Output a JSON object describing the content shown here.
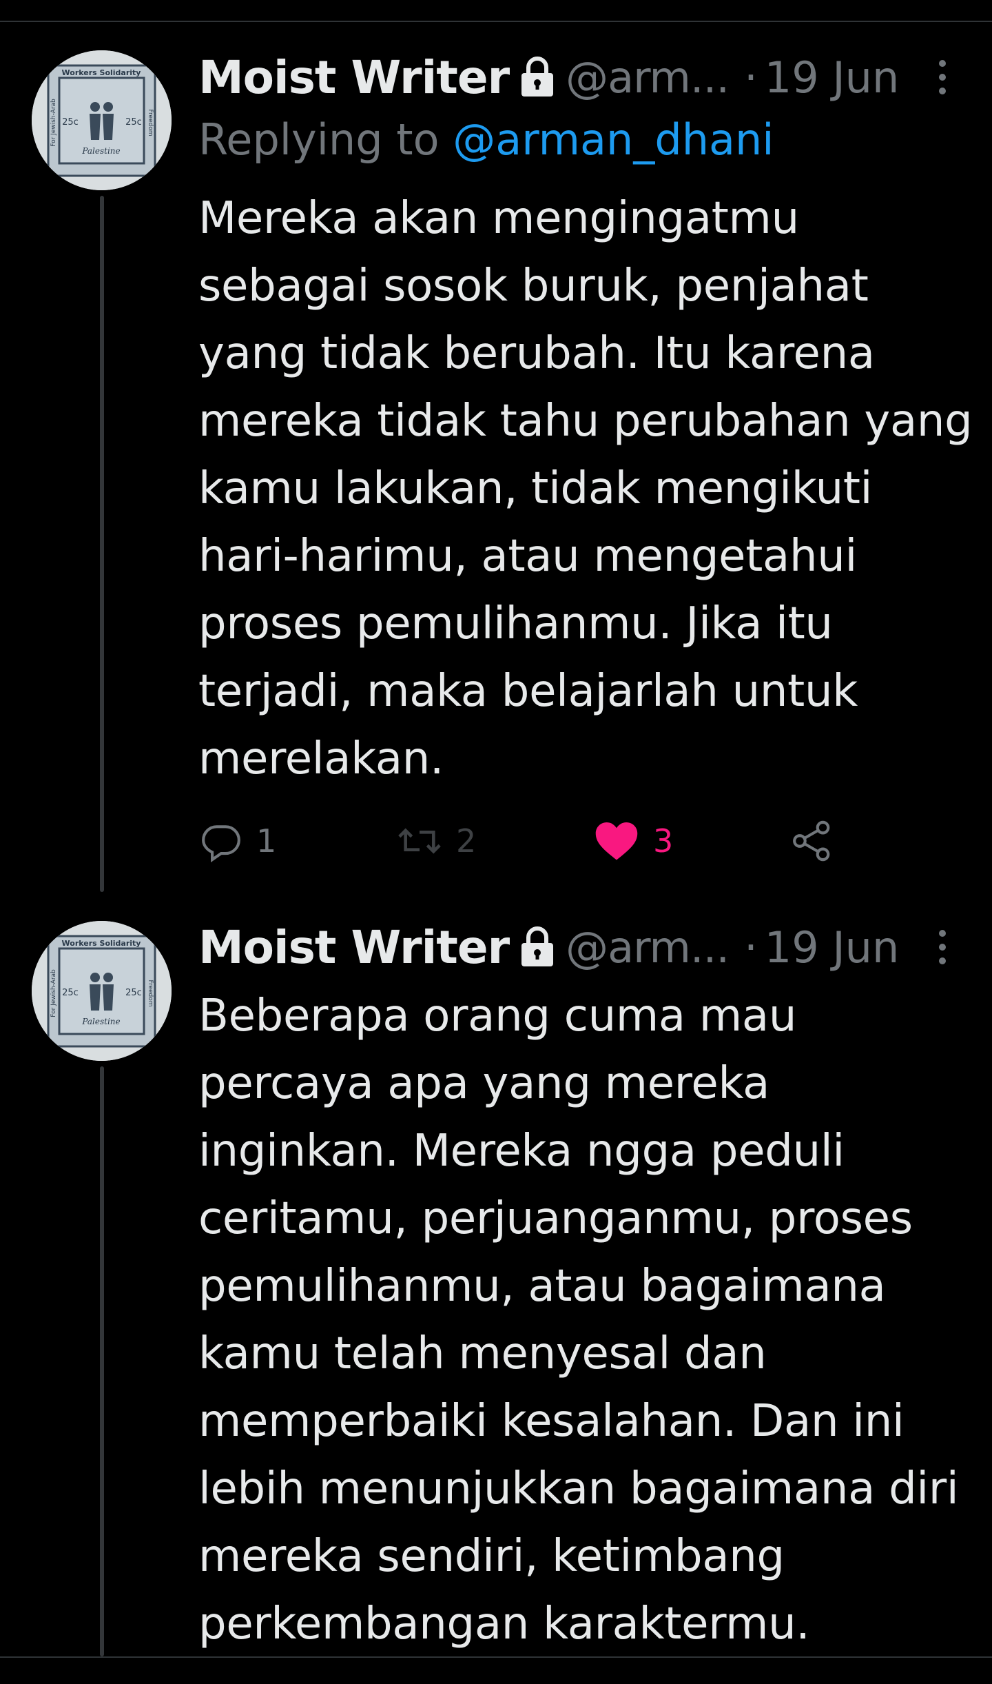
{
  "tweets": [
    {
      "author_name": "Moist Writer",
      "handle": "@arm...",
      "separator": "·",
      "date": "19 Jun",
      "replying_to_label": "Replying to",
      "replying_to_handle": "@arman_dhani",
      "text": "Mereka akan mengingatmu sebagai sosok buruk, penjahat yang tidak berubah. Itu karena mereka tidak tahu perubahan yang kamu lakukan, tidak mengikuti hari-harimu, atau mengetahui proses pemulihanmu. Jika itu terjadi, maka belajarlah untuk merelakan.",
      "reply_count": "1",
      "retweet_count": "2",
      "like_count": "3",
      "liked": true
    },
    {
      "author_name": "Moist Writer",
      "handle": "@arm...",
      "separator": "·",
      "date": "19 Jun",
      "text": "Beberapa orang cuma mau percaya apa yang mereka inginkan. Mereka ngga peduli ceritamu, perjuanganmu, proses pemulihanmu, atau bagaimana kamu telah menyesal dan memperbaiki kesalahan. Dan ini lebih menunjukkan bagaimana diri mereka sendiri, ketimbang perkembangan karaktermu."
    }
  ],
  "avatar": {
    "stamp_text_top": "Workers Solidarity",
    "stamp_text_left": "For Jewish-Arab",
    "stamp_text_right": "Freedom",
    "stamp_value_left": "25c",
    "stamp_value_right": "25c",
    "stamp_place": "Palestine"
  },
  "colors": {
    "background": "#000000",
    "text": "#e7e9ea",
    "secondary": "#71767b",
    "link": "#1d9bf0",
    "like": "#f91880",
    "divider": "#2f3336",
    "thread_line": "#333639"
  },
  "icons": {
    "lock": "lock-icon",
    "more": "more-vertical-icon",
    "reply": "reply-bubble-icon",
    "retweet": "retweet-icon",
    "like": "heart-filled-icon",
    "share": "share-icon"
  }
}
